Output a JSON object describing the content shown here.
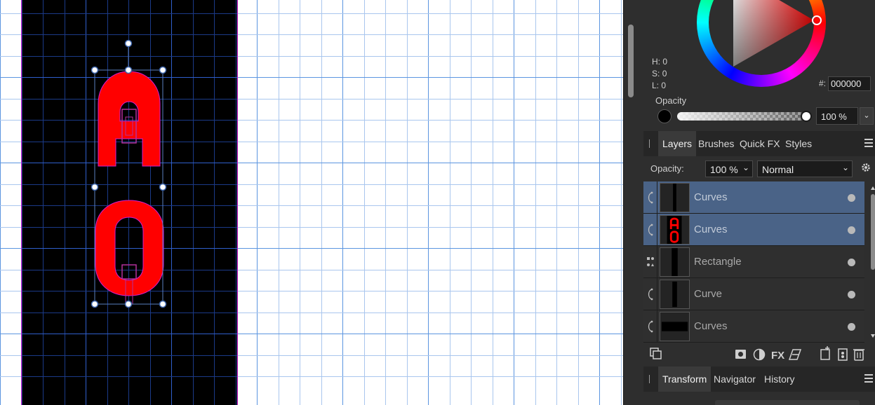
{
  "color": {
    "h_label": "H:",
    "h_value": "0",
    "s_label": "S:",
    "s_value": "0",
    "l_label": "L:",
    "l_value": "0",
    "hex_hash": "#:",
    "hex_value": "000000",
    "opacity_title": "Opacity",
    "opacity_value": "100 %",
    "opacity_fraction": 1.0
  },
  "layers_tabs": [
    "Layers",
    "Brushes",
    "Quick FX",
    "Styles"
  ],
  "layer_controls": {
    "opacity_label": "Opacity:",
    "opacity_value": "100 %",
    "blend_mode": "Normal"
  },
  "layers": [
    {
      "name": "Curves",
      "selected": true,
      "type_icon": "curve-icon"
    },
    {
      "name": "Curves",
      "selected": true,
      "type_icon": "curve-icon"
    },
    {
      "name": "Rectangle",
      "selected": false,
      "type_icon": "shape-icon"
    },
    {
      "name": "Curve",
      "selected": false,
      "type_icon": "curve-icon"
    },
    {
      "name": "Curves",
      "selected": false,
      "type_icon": "curve-icon"
    }
  ],
  "bottom_tabs": [
    "Transform",
    "Navigator",
    "History"
  ],
  "colors": {
    "accent": "#4a6387",
    "glyph_fill": "#ff0000",
    "artboard_border": "#d11fd1",
    "grid": "#2f6fd4"
  }
}
